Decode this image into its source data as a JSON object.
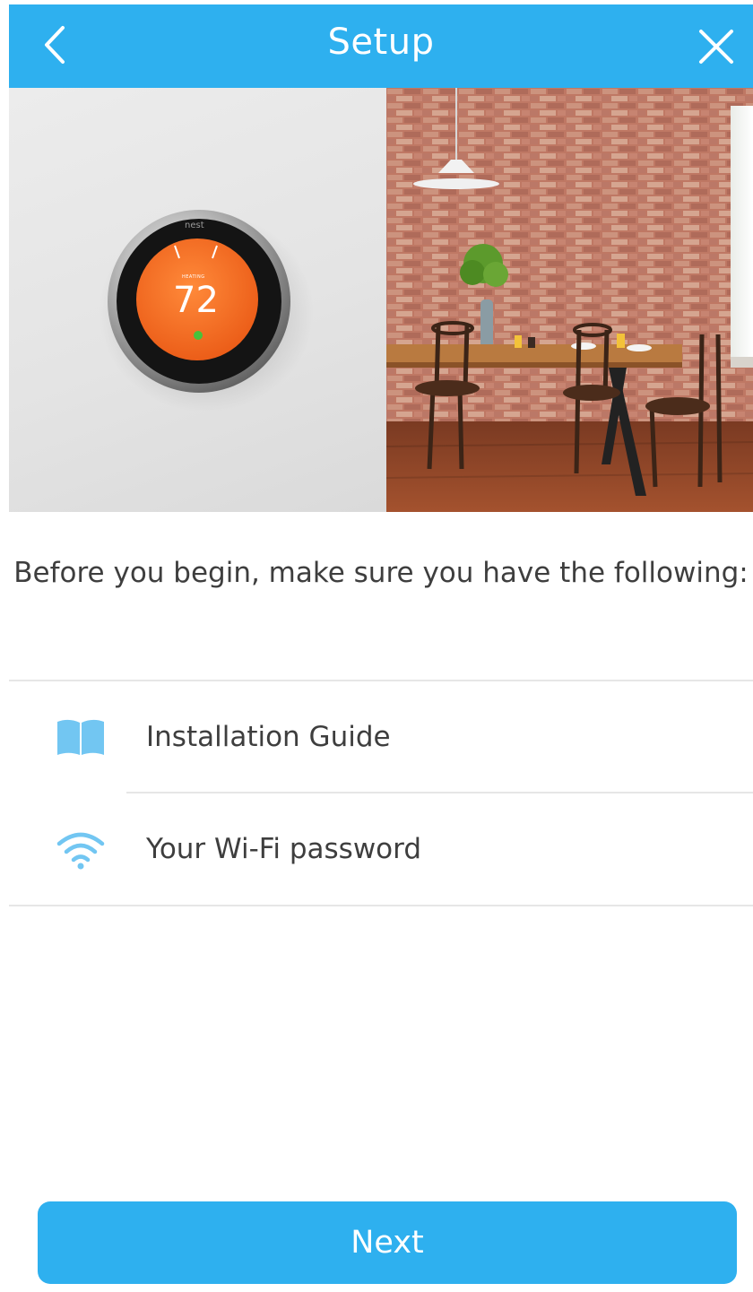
{
  "header": {
    "title": "Setup",
    "back_icon": "chevron-left-icon",
    "close_icon": "close-icon"
  },
  "hero": {
    "thermostat": {
      "brand": "nest",
      "mode": "HEATING",
      "temperature": "72"
    }
  },
  "intro": {
    "text": "Before you begin, make sure you have the following:"
  },
  "checklist": [
    {
      "icon": "book-icon",
      "label": "Installation Guide"
    },
    {
      "icon": "wifi-icon",
      "label": "Your Wi-Fi password"
    }
  ],
  "footer": {
    "next_label": "Next"
  },
  "colors": {
    "accent": "#2eb0ef",
    "text": "#3e3e3e",
    "thermostat_orange": "#f06a22",
    "icon_blue": "#72c6f2"
  }
}
